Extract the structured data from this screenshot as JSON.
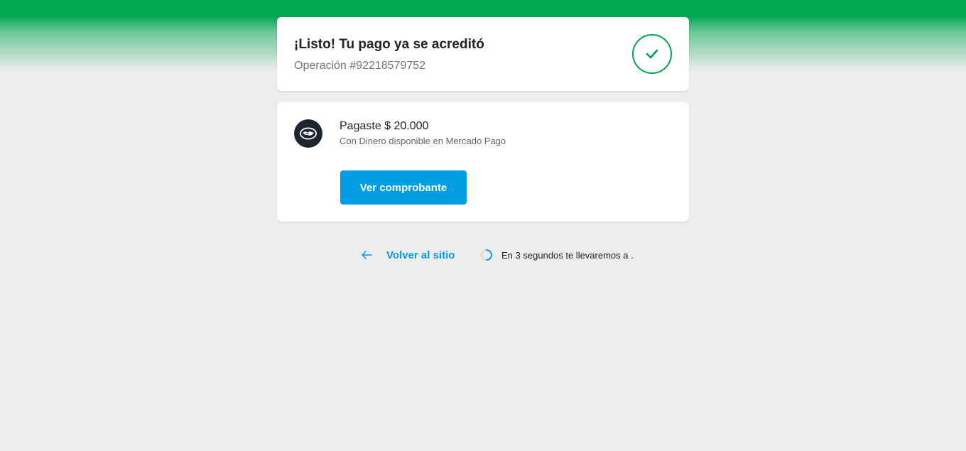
{
  "status": {
    "title": "¡Listo! Tu pago ya se acreditó",
    "operation": "Operación #92218579752",
    "icon": "check-icon",
    "accent_color": "#00a650"
  },
  "payment": {
    "amount_text": "Pagaste $ 20.000",
    "method_text": "Con Dinero disponible en Mercado Pago",
    "avatar_icon": "mercado-pago-handshake-icon",
    "receipt_button": "Ver comprobante",
    "button_color": "#009ee3"
  },
  "footer": {
    "back_label": "Volver al sitio",
    "back_icon": "arrow-left-icon",
    "redirect_text": "En 3 segundos te llevaremos a .",
    "spinner_icon": "loading-spinner-icon"
  }
}
